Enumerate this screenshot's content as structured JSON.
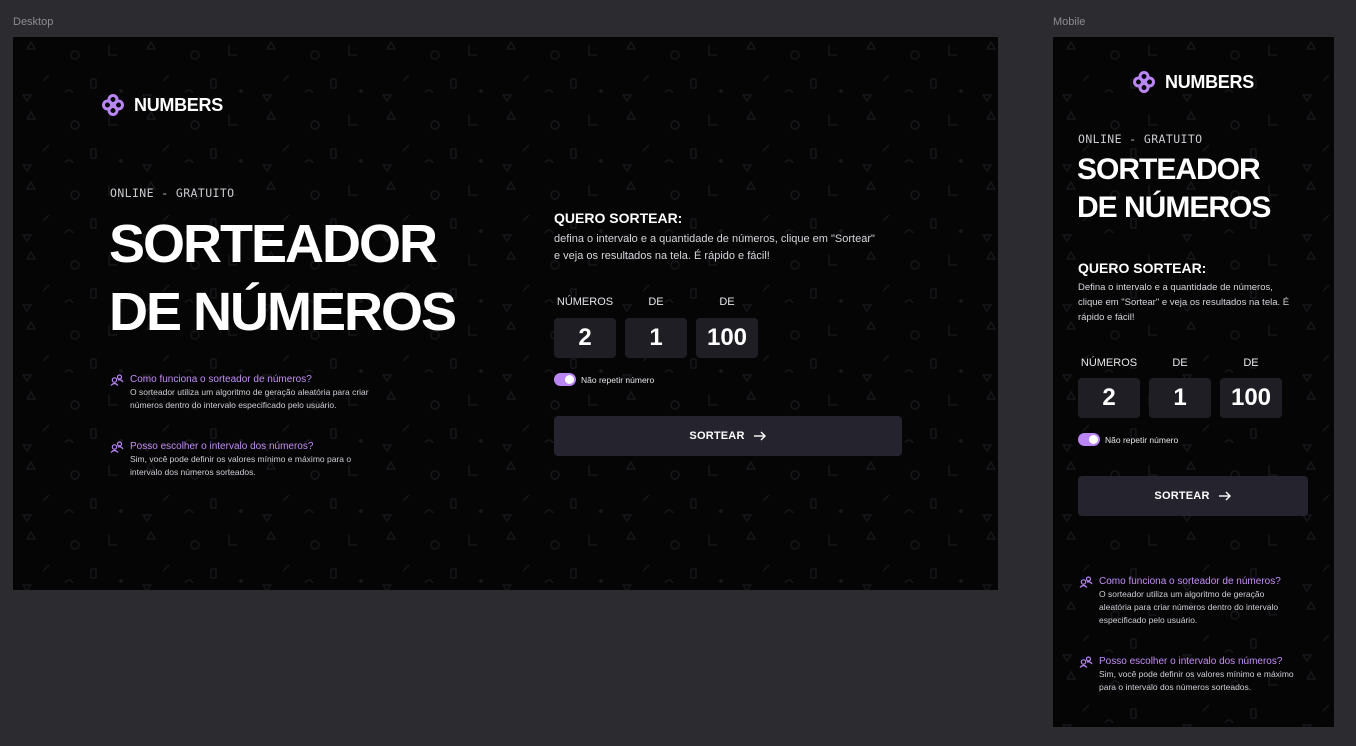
{
  "canvas": {
    "desktop_label": "Desktop",
    "mobile_label": "Mobile"
  },
  "brand": {
    "logo_icon": "flower-logo-icon",
    "name": "NUMBERS",
    "accent_color": "#b986f3"
  },
  "hero": {
    "eyebrow": "ONLINE - GRATUITO",
    "title_line1": "SORTEADOR",
    "title_line2": "DE NÚMEROS"
  },
  "faq": [
    {
      "icon": "people-icon",
      "question": "Como funciona o sorteador de números?",
      "answer_desktop_line1": "O sorteador utiliza um algoritmo de geração aleatória para criar",
      "answer_desktop_line2": "números dentro do intervalo especificado pelo usuário.",
      "answer_mobile_line1": "O sorteador utiliza um algoritmo de geração",
      "answer_mobile_line2": "aleatória para criar números dentro do intervalo",
      "answer_mobile_line3": "especificado pelo usuário."
    },
    {
      "icon": "people-icon",
      "question": "Posso escolher o intervalo dos números?",
      "answer_desktop_line1": "Sim, você pode definir os valores mínimo e máximo para o",
      "answer_desktop_line2": "intervalo dos números sorteados.",
      "answer_mobile_line1": "Sim, você pode definir os valores mínimo e máximo",
      "answer_mobile_line2": "para o intervalo dos números sorteados."
    }
  ],
  "form": {
    "title": "QUERO SORTEAR:",
    "desc_desktop_line1": "defina o intervalo e a quantidade de números, clique em \"Sortear\"",
    "desc_desktop_line2": "e veja os resultados na tela. É rápido e fácil!",
    "desc_mobile_line1": "Defina o intervalo e a quantidade de números,",
    "desc_mobile_line2": "clique em \"Sortear\" e veja os resultados na tela. É",
    "desc_mobile_line3": "rápido e fácil!",
    "fields": [
      {
        "label": "NÚMEROS",
        "value": "2"
      },
      {
        "label": "DE",
        "value": "1"
      },
      {
        "label": "DE",
        "value": "100"
      }
    ],
    "toggle_label": "Não repetir número",
    "toggle_on": true,
    "button_label": "SORTEAR",
    "button_icon": "arrow-right-icon"
  }
}
